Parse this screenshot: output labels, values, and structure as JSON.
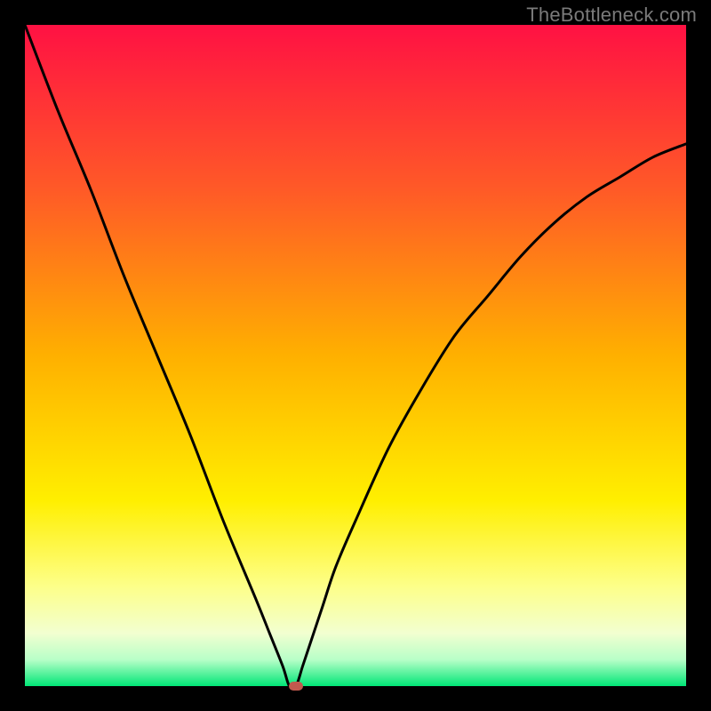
{
  "watermark": "TheBottleneck.com",
  "colors": {
    "frame_bg": "#000000",
    "watermark_text": "#7a7a7a",
    "curve_stroke": "#000000",
    "marker_fill": "#c1594e",
    "gradient_stops": [
      {
        "offset": 0.0,
        "color": "#ff1143"
      },
      {
        "offset": 0.25,
        "color": "#ff5a27"
      },
      {
        "offset": 0.5,
        "color": "#ffb000"
      },
      {
        "offset": 0.72,
        "color": "#ffef00"
      },
      {
        "offset": 0.85,
        "color": "#fdff8a"
      },
      {
        "offset": 0.92,
        "color": "#f2ffd0"
      },
      {
        "offset": 0.96,
        "color": "#b8ffc8"
      },
      {
        "offset": 1.0,
        "color": "#00e676"
      }
    ]
  },
  "chart_data": {
    "type": "line",
    "title": "",
    "xlabel": "",
    "ylabel": "",
    "xlim": [
      0,
      100
    ],
    "ylim": [
      0,
      100
    ],
    "x": [
      0,
      5,
      10,
      15,
      20,
      25,
      30,
      35,
      37,
      39,
      40,
      41,
      42,
      43,
      45,
      47,
      50,
      55,
      60,
      65,
      70,
      75,
      80,
      85,
      90,
      95,
      100
    ],
    "values": [
      100,
      87,
      75,
      62,
      50,
      38,
      25,
      13,
      8,
      3,
      0,
      0,
      3,
      6,
      12,
      18,
      25,
      36,
      45,
      53,
      59,
      65,
      70,
      74,
      77,
      80,
      82
    ],
    "marker": {
      "x": 41,
      "y": 0
    }
  }
}
